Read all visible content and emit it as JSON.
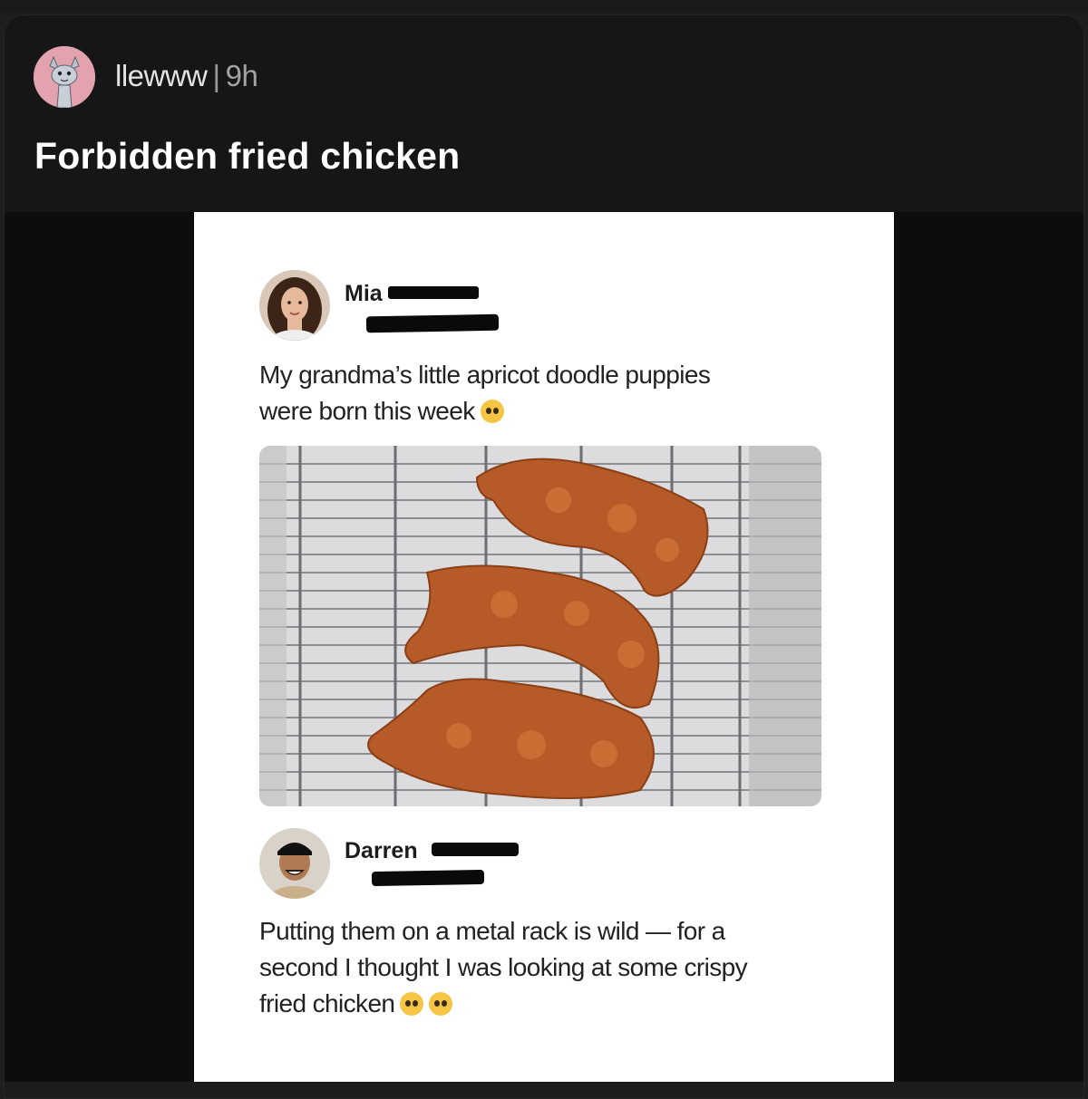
{
  "post": {
    "username": "llewww",
    "separator": "|",
    "time": "9h",
    "title": "Forbidden fried chicken",
    "avatar_icon": "cartoon-cat-avatar-icon"
  },
  "screenshot": {
    "first_post": {
      "name": "Mia",
      "text_line1": "My grandma’s little apricot doodle puppies",
      "text_line2": "were born this week",
      "emoji": "pleading-face-emoji"
    },
    "image": {
      "description_icon": "puppies-on-cooling-rack-photo"
    },
    "reply": {
      "name": "Darren",
      "text_line1": "Putting them on a metal rack is wild — for a",
      "text_line2": "second I thought I was looking at some crispy",
      "text_line3": "fried chicken",
      "emoji": "crying-face-emoji"
    }
  },
  "colors": {
    "card_bg": "#161616",
    "media_bg": "#0d0d0d",
    "title": "#ffffff",
    "avatar_bg": "#e3a3ae"
  }
}
